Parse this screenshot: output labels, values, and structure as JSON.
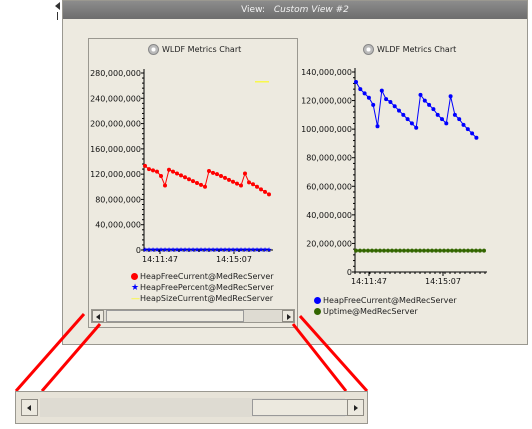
{
  "header": {
    "label": "View:",
    "value": "Custom View #2"
  },
  "charts": [
    {
      "title": "WLDF Metrics Chart",
      "x_ticks": [
        "14:11:47",
        "14:15:07"
      ],
      "legend": [
        {
          "label": "HeapFreeCurrent@MedRecServer",
          "color": "#ff0000",
          "marker": "circle"
        },
        {
          "label": "HeapFreePercent@MedRecServer",
          "color": "#0000ff",
          "marker": "star"
        },
        {
          "label": "HeapSizeCurrent@MedRecServer",
          "color": "#ffff00",
          "marker": "line"
        }
      ]
    },
    {
      "title": "WLDF Metrics Chart",
      "x_ticks": [
        "14:11:47",
        "14:15:07"
      ],
      "legend": [
        {
          "label": "HeapFreeCurrent@MedRecServer",
          "color": "#0000ff",
          "marker": "circle"
        },
        {
          "label": "Uptime@MedRecServer",
          "color": "#336600",
          "marker": "circle"
        }
      ]
    }
  ],
  "chart_data": [
    {
      "type": "line",
      "title": "WLDF Metrics Chart",
      "ylim": [
        0,
        280000000
      ],
      "y_ticks": [
        "0",
        "40,000,000",
        "80,000,000",
        "120,000,000",
        "160,000,000",
        "200,000,000",
        "240,000,000",
        "280,000,000"
      ],
      "x_ticks": [
        "14:11:47",
        "14:15:07"
      ],
      "grid": false,
      "legend_position": "bottom",
      "series": [
        {
          "name": "HeapFreeCurrent@MedRecServer",
          "color": "#ff0000",
          "values": [
            133000000,
            128000000,
            126000000,
            124000000,
            117000000,
            102000000,
            127000000,
            124000000,
            121000000,
            118000000,
            115000000,
            112000000,
            109000000,
            106000000,
            103000000,
            100000000,
            125000000,
            122000000,
            120000000,
            117000000,
            114000000,
            111000000,
            108000000,
            105000000,
            102000000,
            121000000,
            107000000,
            104000000,
            100000000,
            96000000,
            92000000,
            88000000
          ]
        },
        {
          "name": "HeapFreePercent@MedRecServer",
          "color": "#0000ff",
          "values": [
            38,
            38,
            38,
            38,
            38,
            37,
            38,
            38,
            38,
            38,
            38,
            37,
            37,
            37,
            37,
            37,
            38,
            38,
            38,
            38,
            38,
            37,
            37,
            37,
            37,
            38,
            37,
            37,
            37,
            37,
            36,
            36
          ]
        },
        {
          "name": "HeapSizeCurrent@MedRecServer",
          "color": "#ffff00",
          "values_visible_tail": [
            266000000,
            266000000,
            266000000,
            266000000,
            266000000
          ]
        }
      ]
    },
    {
      "type": "line",
      "title": "WLDF Metrics Chart",
      "ylim": [
        0,
        140000000
      ],
      "y_ticks": [
        "0",
        "20,000,000",
        "40,000,000",
        "60,000,000",
        "80,000,000",
        "100,000,000",
        "120,000,000",
        "140,000,000"
      ],
      "x_ticks": [
        "14:11:47",
        "14:15:07"
      ],
      "grid": false,
      "legend_position": "bottom",
      "series": [
        {
          "name": "HeapFreeCurrent@MedRecServer",
          "color": "#0000ff",
          "values": [
            133000000,
            128000000,
            125000000,
            122000000,
            117000000,
            102000000,
            127000000,
            121000000,
            119000000,
            116000000,
            113000000,
            110000000,
            107000000,
            104000000,
            101000000,
            124000000,
            120000000,
            117000000,
            114000000,
            110000000,
            107000000,
            104000000,
            123000000,
            110000000,
            107000000,
            103000000,
            100000000,
            97000000,
            94000000
          ]
        },
        {
          "name": "Uptime@MedRecServer",
          "color": "#336600",
          "values": [
            15000000,
            15000000,
            15000000,
            15000000,
            15000000,
            15000000,
            15000000,
            15000000,
            15000000,
            15000000,
            15000000,
            15000000,
            15000000,
            15000000,
            15000000,
            15000000,
            15000000,
            15000000,
            15000000,
            15000000,
            15000000,
            15000000,
            15000000,
            15000000,
            15000000,
            15000000,
            15000000,
            15000000,
            15000000,
            15000000,
            15000000,
            15000000,
            15000000
          ]
        }
      ]
    }
  ]
}
